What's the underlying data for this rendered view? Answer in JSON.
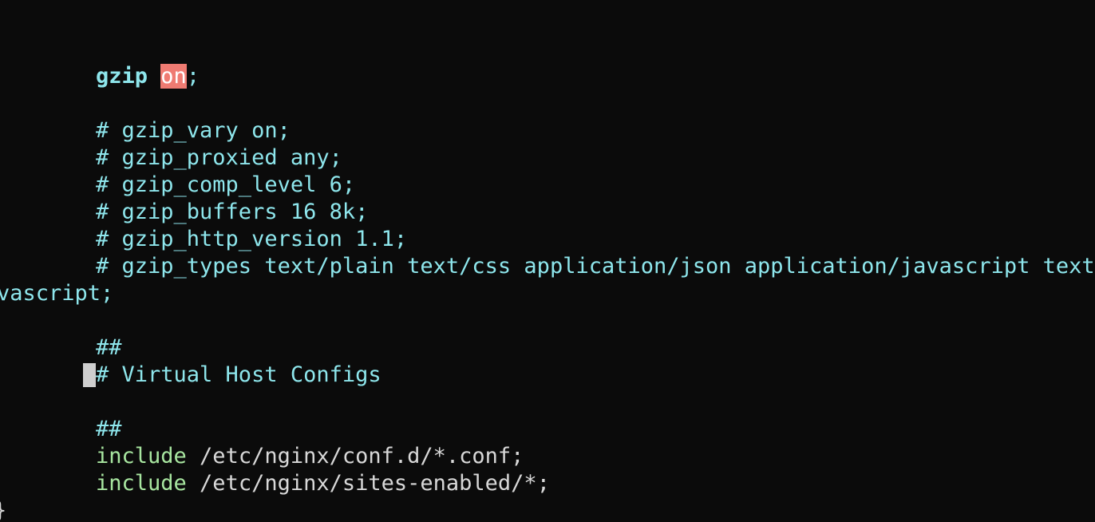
{
  "editor": {
    "gzip_directive": "gzip",
    "gzip_value": "on",
    "gzip_terminator": ";",
    "comment_lines": [
      "# gzip_vary on;",
      "# gzip_proxied any;",
      "# gzip_comp_level 6;",
      "# gzip_buffers 16 8k;",
      "# gzip_http_version 1.1;",
      "# gzip_types text/plain text/css application/json application/javascript text/x"
    ],
    "wrapped_continuation": "vascript;",
    "section_header": {
      "top": "##",
      "title": "# Virtual Host Configs",
      "bottom": "##"
    },
    "includes": [
      {
        "keyword": "include",
        "path": " /etc/nginx/conf.d/*.conf;"
      },
      {
        "keyword": "include",
        "path": " /etc/nginx/sites-enabled/*;"
      }
    ],
    "closing_brace": "}"
  }
}
